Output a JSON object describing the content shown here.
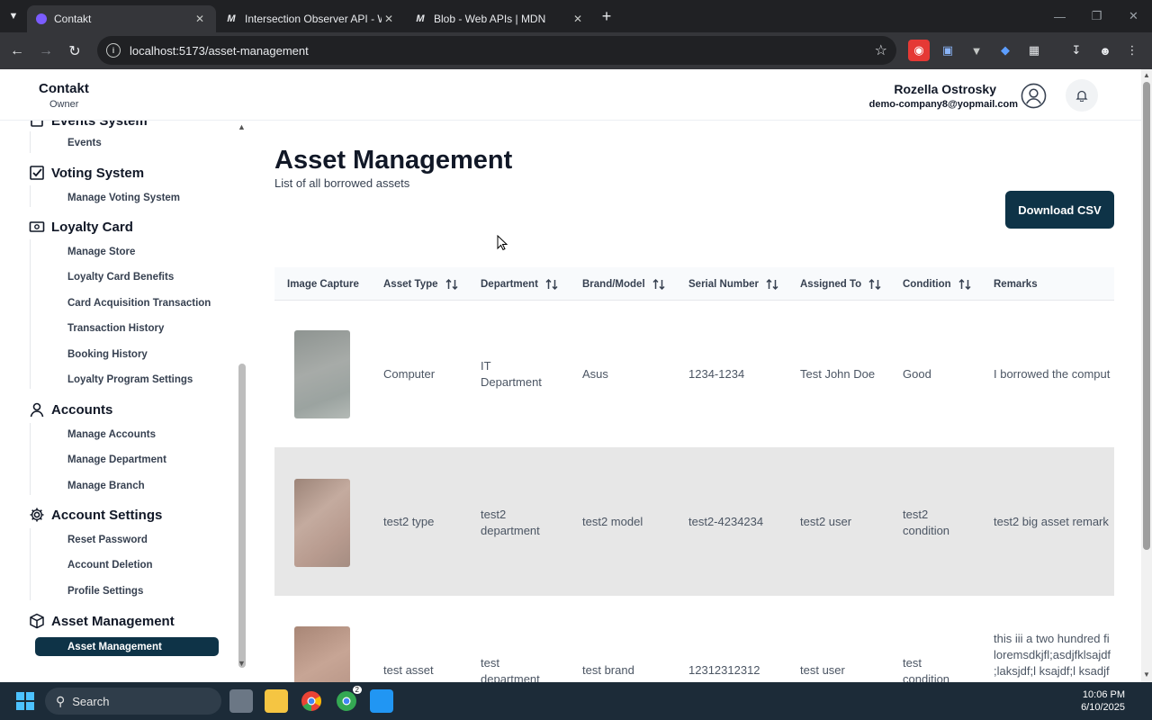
{
  "browser": {
    "tabs": [
      {
        "title": "Contakt",
        "active": true
      },
      {
        "title": "Intersection Observer API - Web",
        "active": false
      },
      {
        "title": "Blob - Web APIs | MDN",
        "active": false
      }
    ],
    "url": "localhost:5173/asset-management"
  },
  "header": {
    "brand": "Contakt",
    "role": "Owner",
    "user_name": "Rozella Ostrosky",
    "user_email": "demo-company8@yopmail.com"
  },
  "sidebar": {
    "sections": [
      {
        "title": "Events System",
        "items": [
          "Events"
        ]
      },
      {
        "title": "Voting System",
        "items": [
          "Manage Voting System"
        ]
      },
      {
        "title": "Loyalty Card",
        "items": [
          "Manage Store",
          "Loyalty Card Benefits",
          "Card Acquisition Transaction",
          "Transaction History",
          "Booking History",
          "Loyalty Program Settings"
        ]
      },
      {
        "title": "Accounts",
        "items": [
          "Manage Accounts",
          "Manage Department",
          "Manage Branch"
        ]
      },
      {
        "title": "Account Settings",
        "items": [
          "Reset Password",
          "Account Deletion",
          "Profile Settings"
        ]
      },
      {
        "title": "Asset Management",
        "items": [
          "Asset Management"
        ]
      }
    ]
  },
  "page": {
    "title": "Asset Management",
    "subtitle": "List of all borrowed assets",
    "download_label": "Download CSV"
  },
  "table": {
    "columns": [
      "Image Capture",
      "Asset Type",
      "Department",
      "Brand/Model",
      "Serial Number",
      "Assigned To",
      "Condition",
      "Remarks"
    ],
    "rows": [
      {
        "asset_type": "Computer",
        "department": [
          "IT",
          "Department"
        ],
        "brand": "Asus",
        "serial": "1234-1234",
        "assigned": "Test John Doe",
        "condition": [
          "Good"
        ],
        "remarks": [
          "I borrowed the comput"
        ]
      },
      {
        "asset_type": "test2 type",
        "department": [
          "test2",
          "department"
        ],
        "brand": "test2 model",
        "serial": "test2-4234234",
        "assigned": "test2 user",
        "condition": [
          "test2",
          "condition"
        ],
        "remarks": [
          "test2 big asset remark"
        ]
      },
      {
        "asset_type": "test asset",
        "department": [
          "test",
          "department"
        ],
        "brand": "test brand",
        "serial": "12312312312",
        "assigned": "test user",
        "condition": [
          "test",
          "condition"
        ],
        "remarks": [
          "this iii a two hundred fi",
          "loremsdkjfl;asdjfklsajdf",
          ";laksjdf;l ksajdf;l ksadjf"
        ]
      }
    ]
  },
  "taskbar": {
    "search_label": "Search",
    "time": "10:06 PM",
    "date": "6/10/2025",
    "chrome_badge": "2"
  },
  "colors": {
    "primary": "#0e3347",
    "row_highlight": "#e7e7e7"
  }
}
